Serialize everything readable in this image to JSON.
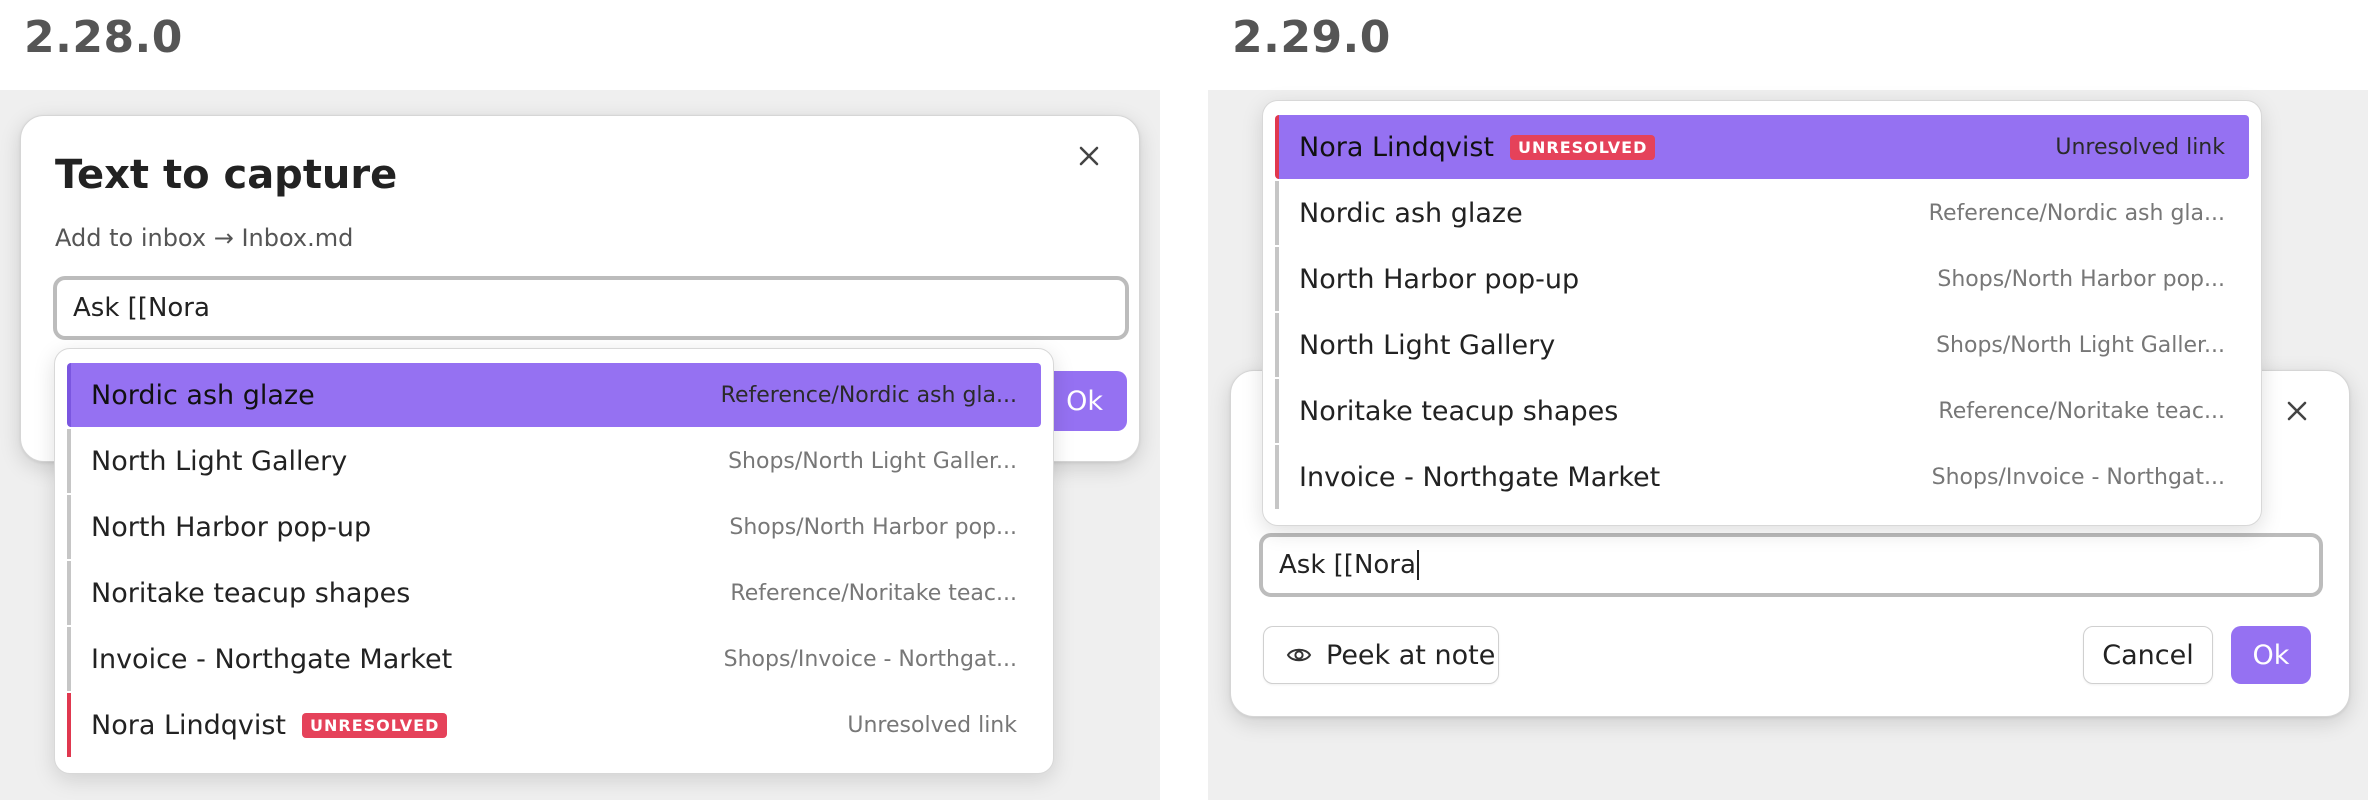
{
  "left": {
    "version": "2.28.0",
    "modal": {
      "title": "Text to capture",
      "subtitle": "Add to inbox → Inbox.md",
      "input_value": "Ask [[Nora",
      "ok_label": "Ok"
    },
    "suggestions": [
      {
        "title": "Nordic ash glaze",
        "path": "Reference/Nordic ash gla...",
        "selected": true
      },
      {
        "title": "North Light Gallery",
        "path": "Shops/North Light Galler..."
      },
      {
        "title": "North Harbor pop-up",
        "path": "Shops/North Harbor pop..."
      },
      {
        "title": "Noritake teacup shapes",
        "path": "Reference/Noritake teac..."
      },
      {
        "title": "Invoice - Northgate Market",
        "path": "Shops/Invoice - Northgat..."
      },
      {
        "title": "Nora Lindqvist",
        "badge": "UNRESOLVED",
        "path": "Unresolved link",
        "unresolved": true
      }
    ]
  },
  "right": {
    "version": "2.29.0",
    "suggestions": [
      {
        "title": "Nora Lindqvist",
        "badge": "UNRESOLVED",
        "path": "Unresolved link",
        "unresolved": true,
        "selected": true
      },
      {
        "title": "Nordic ash glaze",
        "path": "Reference/Nordic ash gla..."
      },
      {
        "title": "North Harbor pop-up",
        "path": "Shops/North Harbor pop..."
      },
      {
        "title": "North Light Gallery",
        "path": "Shops/North Light Galler..."
      },
      {
        "title": "Noritake teacup shapes",
        "path": "Reference/Noritake teac..."
      },
      {
        "title": "Invoice - Northgate Market",
        "path": "Shops/Invoice - Northgat..."
      }
    ],
    "modal": {
      "input_value": "Ask [[Nora",
      "peek_label": "Peek at note",
      "cancel_label": "Cancel",
      "ok_label": "Ok"
    }
  },
  "colors": {
    "accent": "#9571f2",
    "badge": "#e5425a",
    "unresolved_bar": "#e0384f"
  },
  "icons": {
    "close": "close-icon",
    "eye": "eye-icon"
  }
}
